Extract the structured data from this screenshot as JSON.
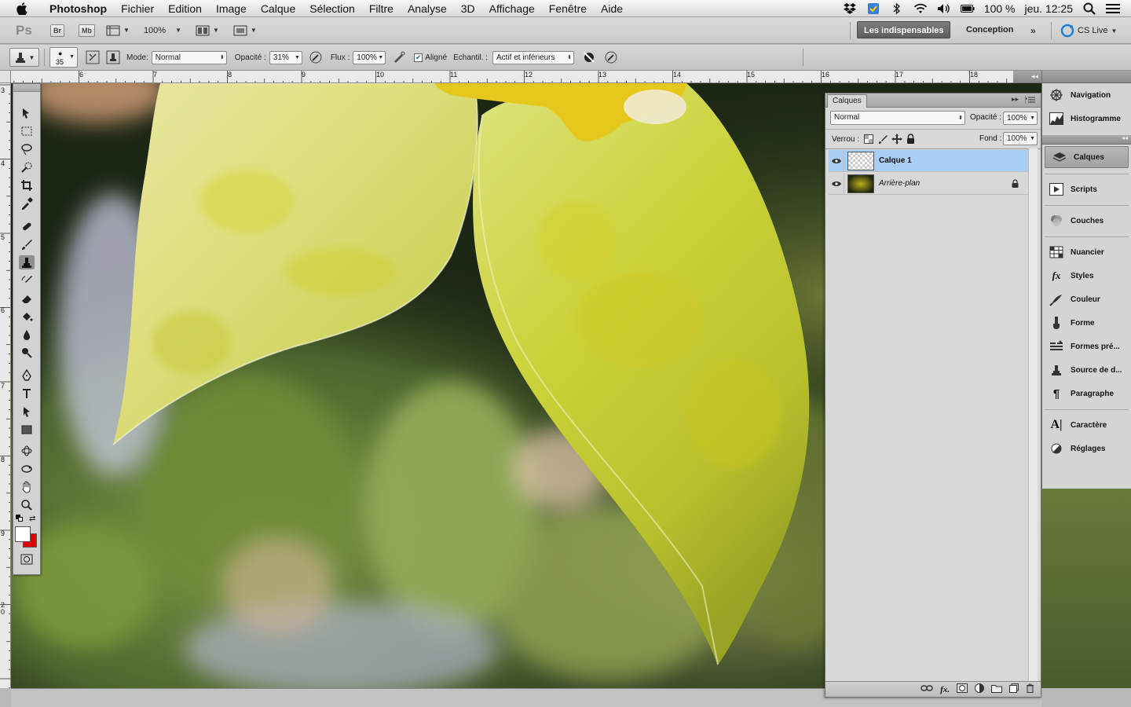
{
  "menubar": {
    "app": "Photoshop",
    "items": [
      "Fichier",
      "Edition",
      "Image",
      "Calque",
      "Sélection",
      "Filtre",
      "Analyse",
      "3D",
      "Affichage",
      "Fenêtre",
      "Aide"
    ],
    "battery": "100 %",
    "clock": "jeu. 12:25"
  },
  "appbar": {
    "logo": "Ps",
    "bridge": "Br",
    "minibridge": "Mb",
    "zoom": "100%",
    "workspaces": [
      "Les indispensables",
      "Conception"
    ],
    "cs_live": "CS Live"
  },
  "options": {
    "brush_size": "35",
    "mode_label": "Mode:",
    "mode_value": "Normal",
    "opacity_label": "Opacité :",
    "opacity_value": "31%",
    "flow_label": "Flux :",
    "flow_value": "100%",
    "aligned_label": "Aligné",
    "sample_label": "Echantil. :",
    "sample_value": "Actif et inférieurs"
  },
  "ruler_top": [
    "6",
    "7",
    "8",
    "9",
    "10",
    "11",
    "12",
    "13",
    "14",
    "15",
    "16",
    "17",
    "18"
  ],
  "ruler_left": [
    "3",
    "4",
    "5",
    "6",
    "7",
    "8",
    "9",
    "2 0"
  ],
  "layers_panel": {
    "tab": "Calques",
    "blend_mode": "Normal",
    "opacity_label": "Opacité :",
    "opacity_value": "100%",
    "lock_label": "Verrou :",
    "fill_label": "Fond :",
    "fill_value": "100%",
    "layers": [
      {
        "name": "Calque 1",
        "selected": true
      },
      {
        "name": "Arrière-plan",
        "selected": false
      }
    ]
  },
  "dock": {
    "group1": [
      "Navigation",
      "Histogramme"
    ],
    "group2": [
      "Calques",
      "Scripts",
      "Couches",
      "Nuancier",
      "Styles",
      "Couleur",
      "Forme",
      "Formes pré...",
      "Source de d...",
      "Paragraphe",
      "Caractère",
      "Réglages"
    ]
  },
  "colors": {
    "selection": "#a9cef5",
    "foreground": "#ffffff",
    "background": "#e00000"
  }
}
